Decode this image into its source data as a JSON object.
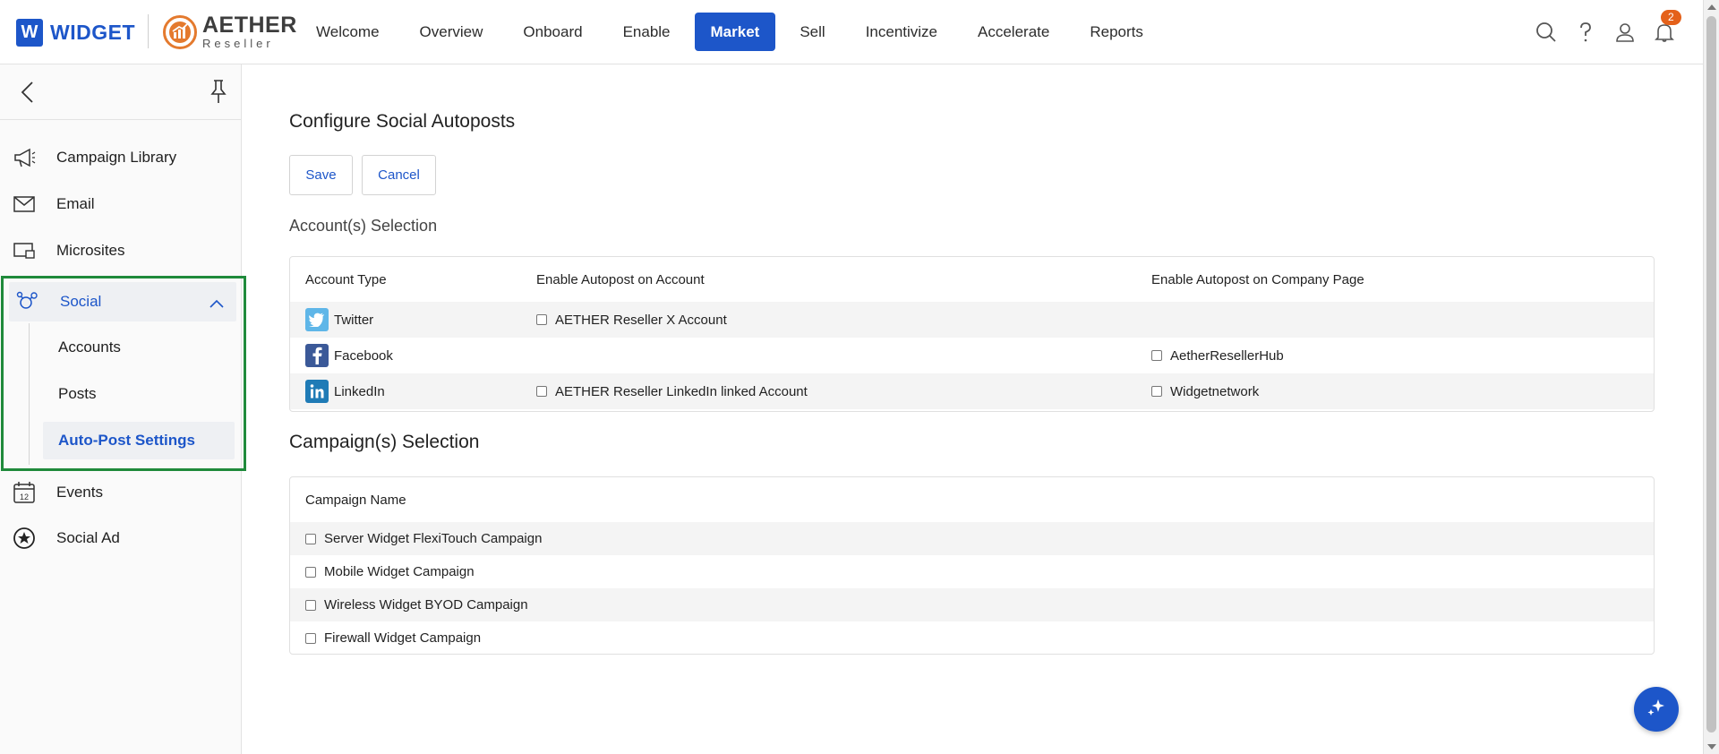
{
  "brand": {
    "primary_letter": "W",
    "primary_name": "WIDGET",
    "secondary_name": "AETHER",
    "secondary_sub": "Reseller"
  },
  "nav": {
    "items": [
      "Welcome",
      "Overview",
      "Onboard",
      "Enable",
      "Market",
      "Sell",
      "Incentivize",
      "Accelerate",
      "Reports"
    ],
    "active": "Market"
  },
  "header_icons": {
    "search": "search-icon",
    "help": "help-icon",
    "profile": "user-icon",
    "notifications": "bell-icon",
    "notification_count": "2"
  },
  "sidebar": {
    "items": [
      {
        "label": "Campaign Library",
        "icon": "megaphone-icon"
      },
      {
        "label": "Email",
        "icon": "envelope-icon"
      },
      {
        "label": "Microsites",
        "icon": "microsite-icon"
      }
    ],
    "social": {
      "label": "Social",
      "icon": "social-icon",
      "sub_items": [
        "Accounts",
        "Posts",
        "Auto-Post Settings"
      ],
      "active_sub": "Auto-Post Settings"
    },
    "items_after": [
      {
        "label": "Events",
        "icon": "calendar-icon",
        "icon_text": "12"
      },
      {
        "label": "Social Ad",
        "icon": "star-badge-icon"
      }
    ]
  },
  "main": {
    "title": "Configure Social Autoposts",
    "save_label": "Save",
    "cancel_label": "Cancel",
    "accounts_section": {
      "title": "Account(s) Selection",
      "headers": [
        "Account Type",
        "Enable Autopost on Account",
        "Enable Autopost on Company Page"
      ],
      "rows": [
        {
          "type": "Twitter",
          "icon": "twitter-icon",
          "account": "AETHER Reseller X Account",
          "page": ""
        },
        {
          "type": "Facebook",
          "icon": "facebook-icon",
          "account": "",
          "page": "AetherResellerHub"
        },
        {
          "type": "LinkedIn",
          "icon": "linkedin-icon",
          "account": "AETHER Reseller LinkedIn linked Account",
          "page": "Widgetnetwork"
        }
      ]
    },
    "campaigns_section": {
      "title": "Campaign(s) Selection",
      "header": "Campaign Name",
      "campaigns": [
        "Server Widget FlexiTouch Campaign",
        "Mobile Widget Campaign",
        "Wireless Widget BYOD Campaign",
        "Firewall Widget Campaign"
      ]
    }
  },
  "colors": {
    "accent": "#1d56c9",
    "highlight_border": "#1f8a3b",
    "badge": "#e4611a",
    "brand_orange": "#e47a2e"
  }
}
